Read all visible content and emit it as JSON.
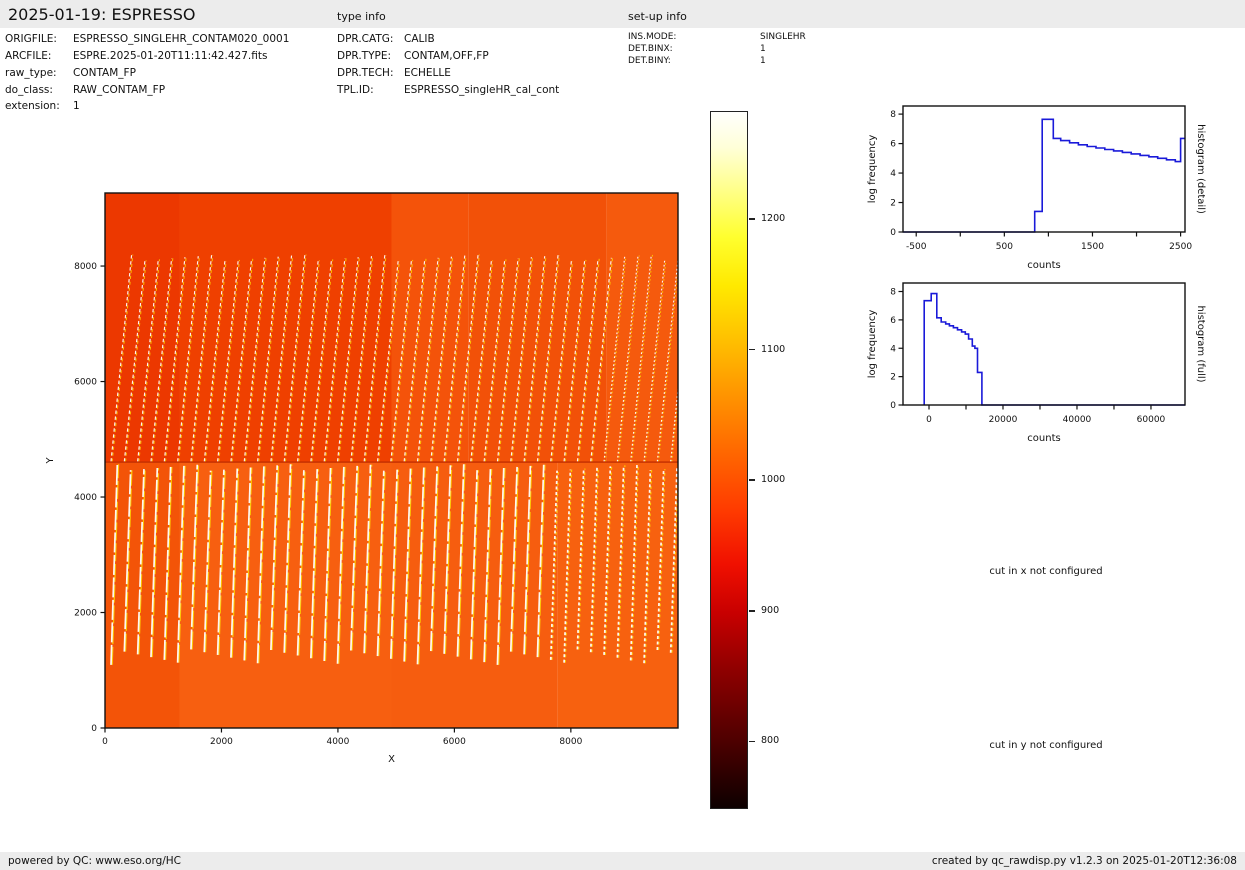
{
  "header": {
    "title": "2025-01-19: ESPRESSO",
    "sections": [
      {
        "label": "type info"
      },
      {
        "label": "set-up info"
      }
    ]
  },
  "file_info": {
    "rows": [
      {
        "label": "ORIGFILE:",
        "value": "ESPRESSO_SINGLEHR_CONTAM020_0001"
      },
      {
        "label": "ARCFILE:",
        "value": "ESPRE.2025-01-20T11:11:42.427.fits"
      },
      {
        "label": "raw_type:",
        "value": "CONTAM_FP"
      },
      {
        "label": "do_class:",
        "value": "RAW_CONTAM_FP"
      },
      {
        "label": "extension:",
        "value": "1"
      }
    ]
  },
  "type_info": {
    "rows": [
      {
        "label": "DPR.CATG:",
        "value": "CALIB"
      },
      {
        "label": "DPR.TYPE:",
        "value": "CONTAM,OFF,FP"
      },
      {
        "label": "DPR.TECH:",
        "value": "ECHELLE"
      },
      {
        "label": "TPL.ID:",
        "value": "ESPRESSO_singleHR_cal_cont"
      }
    ]
  },
  "setup_info": {
    "rows": [
      {
        "label": "INS.MODE:",
        "value": "SINGLEHR"
      },
      {
        "label": "DET.BINX:",
        "value": "1"
      },
      {
        "label": "DET.BINY:",
        "value": "1"
      }
    ]
  },
  "messages": {
    "cut_x": "cut in x not configured",
    "cut_y": "cut in y not configured"
  },
  "footer": {
    "left": "powered by QC: www.eso.org/HC",
    "right": "created by qc_rawdisp.py v1.2.3 on 2025-01-20T12:36:08"
  },
  "colors": {
    "header_bar": "#ececec",
    "footer_bar": "#ececec",
    "axis": "#111111",
    "histogram_line": "#1a1ad9"
  },
  "chart_data": [
    {
      "name": "detector_image",
      "type": "heatmap",
      "title": "",
      "xlabel": "X",
      "ylabel": "Y",
      "xlim": [
        0,
        9840
      ],
      "ylim": [
        0,
        9265
      ],
      "xticks": [
        0,
        2000,
        4000,
        6000,
        8000
      ],
      "yticks": [
        0,
        2000,
        4000,
        6000,
        8000
      ],
      "colormap": "hot",
      "description": "ESPRESSO raw echelle FP contamination frame: dashed slanted orders in upper detector half, near-vertical bright orders in lower half, plain bands at top and bottom",
      "midline": {
        "y_frac": 0.503,
        "color": "#c43000"
      },
      "bg_regions": [
        {
          "x": [
            0,
            0.13
          ],
          "y": [
            0,
            0.503
          ],
          "color": "#ec3800"
        },
        {
          "x": [
            0.13,
            0.5
          ],
          "y": [
            0,
            0.503
          ],
          "color": "#ef4000"
        },
        {
          "x": [
            0.5,
            0.635
          ],
          "y": [
            0,
            0.503
          ],
          "color": "#f4530a"
        },
        {
          "x": [
            0.635,
            0.875
          ],
          "y": [
            0,
            0.503
          ],
          "color": "#f25108"
        },
        {
          "x": [
            0.875,
            1
          ],
          "y": [
            0,
            0.503
          ],
          "color": "#f55a0d"
        },
        {
          "x": [
            0,
            0.13
          ],
          "y": [
            0.503,
            1
          ],
          "color": "#f35408"
        },
        {
          "x": [
            0.13,
            0.5
          ],
          "y": [
            0.503,
            1
          ],
          "color": "#f75f10"
        },
        {
          "x": [
            0.5,
            0.79
          ],
          "y": [
            0.503,
            1
          ],
          "color": "#f65d0f"
        },
        {
          "x": [
            0.79,
            1
          ],
          "y": [
            0.503,
            1
          ],
          "color": "#f7610f"
        }
      ],
      "orders_upper": {
        "count": 43,
        "tilt_frac": 0.036,
        "top_frac": 0.115,
        "bottom_frac": 0.502,
        "core_width": 1.15,
        "dash": [
          3.4,
          2.6
        ]
      },
      "orders_lower": {
        "count": 43,
        "tilt_frac": 0.011,
        "top_frac": 0.507,
        "bottom_frac": 0.882,
        "core_width": 1.7,
        "dash": [
          20,
          2.5
        ]
      },
      "order_core_color": "#ffffff",
      "order_flank_color": "#ffd800"
    },
    {
      "name": "colorbar",
      "type": "colorbar",
      "colormap": "hot",
      "value_range": [
        749,
        1282
      ],
      "ticks": [
        800,
        900,
        1000,
        1100,
        1200
      ],
      "gradient_stops": [
        [
          "#0d0000",
          0
        ],
        [
          "#500000",
          0.1
        ],
        [
          "#900000",
          0.2
        ],
        [
          "#c80000",
          0.28
        ],
        [
          "#f01000",
          0.35
        ],
        [
          "#ff3c00",
          0.43
        ],
        [
          "#ff6c00",
          0.52
        ],
        [
          "#ff9800",
          0.6
        ],
        [
          "#ffc400",
          0.68
        ],
        [
          "#ffe900",
          0.75
        ],
        [
          "#ffff2e",
          0.82
        ],
        [
          "#ffff8c",
          0.89
        ],
        [
          "#ffffd9",
          0.95
        ],
        [
          "#fffffd",
          1
        ]
      ]
    },
    {
      "name": "histogram_detail",
      "type": "step-line",
      "xlabel": "counts",
      "ylabel": "log frequency",
      "side_label": "histogram (detail)",
      "xlim": [
        -650,
        2550
      ],
      "ylim": [
        0,
        8.55
      ],
      "xticks": [
        -500,
        500,
        1500,
        2500
      ],
      "xticks_minor": [
        0,
        1000,
        2000
      ],
      "yticks": [
        0,
        2,
        4,
        6,
        8
      ],
      "line_color": "#1a1ad9",
      "points": [
        [
          -650,
          0
        ],
        [
          845,
          0
        ],
        [
          845,
          1.4
        ],
        [
          930,
          1.4
        ],
        [
          930,
          7.65
        ],
        [
          1055,
          7.65
        ],
        [
          1055,
          6.35
        ],
        [
          1140,
          6.35
        ],
        [
          1140,
          6.2
        ],
        [
          1240,
          6.2
        ],
        [
          1240,
          6.05
        ],
        [
          1340,
          6.05
        ],
        [
          1340,
          5.92
        ],
        [
          1440,
          5.92
        ],
        [
          1440,
          5.8
        ],
        [
          1540,
          5.8
        ],
        [
          1540,
          5.7
        ],
        [
          1640,
          5.7
        ],
        [
          1640,
          5.6
        ],
        [
          1740,
          5.6
        ],
        [
          1740,
          5.5
        ],
        [
          1840,
          5.5
        ],
        [
          1840,
          5.4
        ],
        [
          1940,
          5.4
        ],
        [
          1940,
          5.3
        ],
        [
          2040,
          5.3
        ],
        [
          2040,
          5.2
        ],
        [
          2140,
          5.2
        ],
        [
          2140,
          5.1
        ],
        [
          2240,
          5.1
        ],
        [
          2240,
          5.0
        ],
        [
          2340,
          5.0
        ],
        [
          2340,
          4.9
        ],
        [
          2440,
          4.9
        ],
        [
          2440,
          4.78
        ],
        [
          2500,
          4.78
        ],
        [
          2500,
          6.35
        ],
        [
          2550,
          6.35
        ]
      ]
    },
    {
      "name": "histogram_full",
      "type": "step-line",
      "xlabel": "counts",
      "ylabel": "log frequency",
      "side_label": "histogram (full)",
      "xlim": [
        -7030,
        69200
      ],
      "ylim": [
        0,
        8.6
      ],
      "xticks": [
        0,
        20000,
        40000,
        60000
      ],
      "xticks_minor": [
        10000,
        30000,
        50000
      ],
      "yticks": [
        0,
        2,
        4,
        6,
        8
      ],
      "line_color": "#1a1ad9",
      "points": [
        [
          -1300,
          0
        ],
        [
          -1300,
          7.35
        ],
        [
          600,
          7.35
        ],
        [
          600,
          7.85
        ],
        [
          2100,
          7.85
        ],
        [
          2100,
          6.15
        ],
        [
          3300,
          6.15
        ],
        [
          3300,
          5.85
        ],
        [
          4500,
          5.85
        ],
        [
          4500,
          5.72
        ],
        [
          5500,
          5.72
        ],
        [
          5500,
          5.58
        ],
        [
          6600,
          5.58
        ],
        [
          6600,
          5.45
        ],
        [
          7700,
          5.45
        ],
        [
          7700,
          5.3
        ],
        [
          8800,
          5.3
        ],
        [
          8800,
          5.15
        ],
        [
          9800,
          5.15
        ],
        [
          9800,
          5.0
        ],
        [
          10700,
          5.0
        ],
        [
          10700,
          4.65
        ],
        [
          11700,
          4.65
        ],
        [
          11700,
          4.15
        ],
        [
          12400,
          4.15
        ],
        [
          12400,
          4.0
        ],
        [
          13100,
          4.0
        ],
        [
          13100,
          2.3
        ],
        [
          14300,
          2.3
        ],
        [
          14300,
          0
        ],
        [
          69200,
          0
        ]
      ]
    }
  ]
}
